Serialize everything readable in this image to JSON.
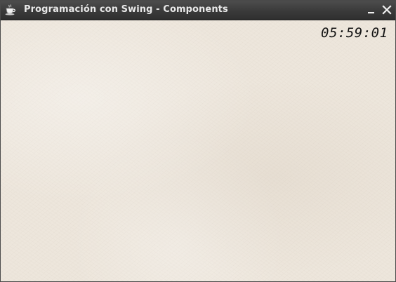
{
  "window": {
    "title": "Programación con Swing - Components",
    "app_icon": "java-cup-icon",
    "controls": {
      "minimize_icon": "minimize-icon",
      "close_icon": "close-icon"
    }
  },
  "content": {
    "clock_text": "05:59:01",
    "background": "light beige leather texture",
    "background_color": "#ede6dc"
  },
  "colors": {
    "titlebar": "#3a3a3a",
    "title_text": "#e8e8e8",
    "clock_text": "#141414"
  }
}
